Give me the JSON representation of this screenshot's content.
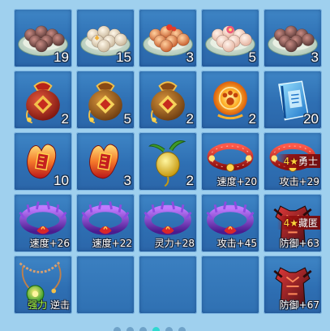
{
  "inventory": {
    "slots": [
      {
        "icon": "sesame-dumpling-plate-icon",
        "count": "19"
      },
      {
        "icon": "white-dumpling-plate-icon",
        "count": "15"
      },
      {
        "icon": "orange-dumpling-plate-icon",
        "count": "3"
      },
      {
        "icon": "flower-dumpling-plate-icon",
        "count": "5"
      },
      {
        "icon": "sesame-dumpling-plate-icon",
        "count": "3"
      },
      {
        "icon": "red-lucky-bag-icon",
        "count": "2"
      },
      {
        "icon": "gold-lucky-bag-icon",
        "count": "5"
      },
      {
        "icon": "gold-lucky-bag-icon",
        "count": "2"
      },
      {
        "icon": "glowing-paw-orb-icon",
        "count": "2"
      },
      {
        "icon": "blue-skill-book-icon",
        "count": "20"
      },
      {
        "icon": "fire-token-icon",
        "count": "10"
      },
      {
        "icon": "fire-token-icon",
        "count": "3"
      },
      {
        "icon": "golden-radish-icon",
        "count": "2"
      },
      {
        "icon": "red-bead-collar-icon",
        "stat": "速度+20"
      },
      {
        "icon": "red-bead-collar-icon",
        "stat": "攻击+29",
        "ribbon": {
          "star": "4★",
          "text": "勇士"
        }
      },
      {
        "icon": "purple-dragon-collar-icon",
        "stat": "速度+26"
      },
      {
        "icon": "purple-dragon-collar-icon",
        "stat": "速度+22"
      },
      {
        "icon": "purple-dragon-collar-icon",
        "stat": "灵力+28"
      },
      {
        "icon": "purple-dragon-collar-icon",
        "stat": "攻击+45"
      },
      {
        "icon": "crimson-armor-icon",
        "stat": "防御+63",
        "ribbon": {
          "star": "4★",
          "text": "藏匿"
        }
      },
      {
        "icon": "jade-pendant-necklace-icon",
        "stat_green": "强力",
        "stat": "逆击"
      },
      {
        "icon": "empty-slot"
      },
      {
        "icon": "empty-slot"
      },
      {
        "icon": "empty-slot"
      },
      {
        "icon": "crimson-armor-icon",
        "stat": "防御+67"
      }
    ]
  },
  "pager": {
    "pages": 6,
    "current": 4
  }
}
